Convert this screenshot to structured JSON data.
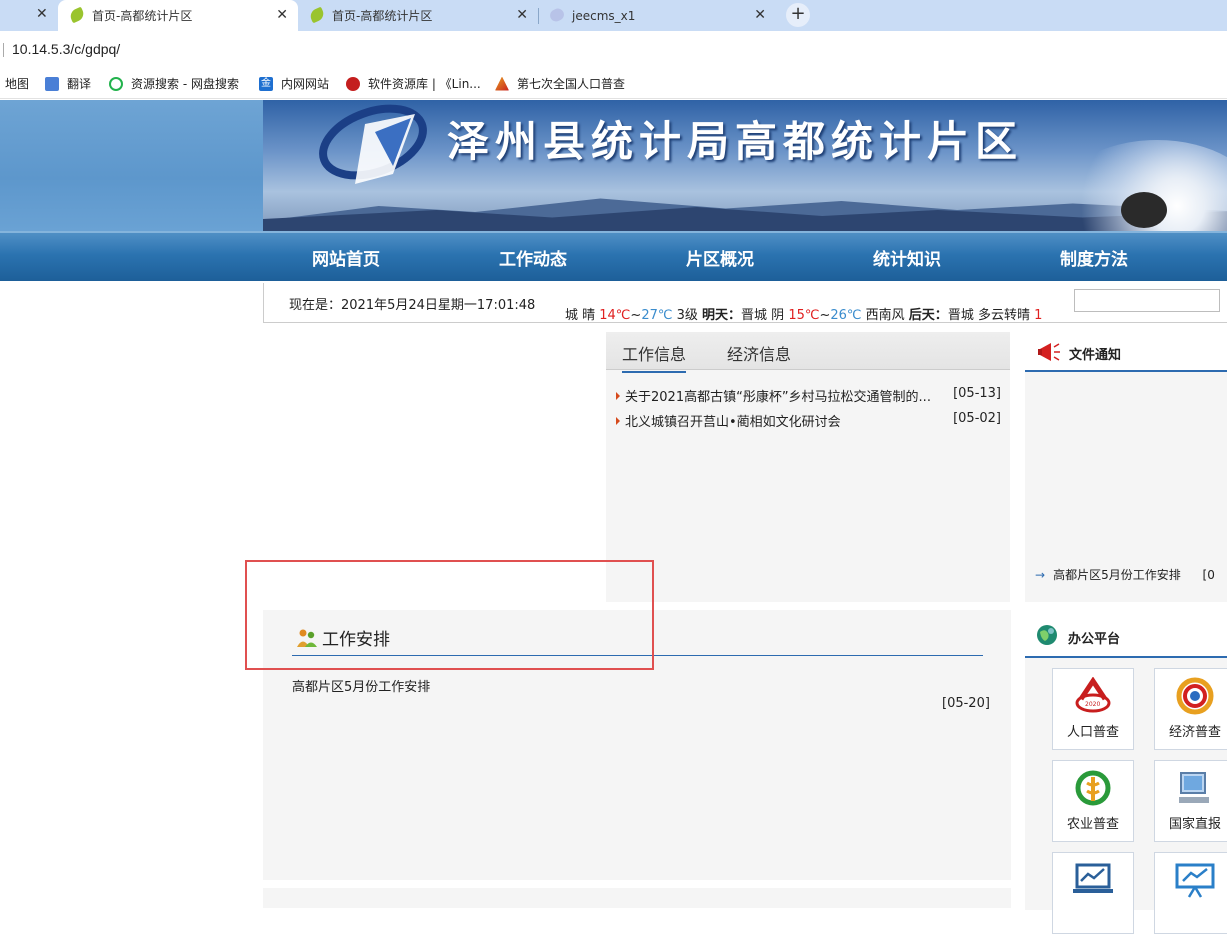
{
  "browser": {
    "tabs": [
      {
        "title": "首页-高都统计片区",
        "active": true
      },
      {
        "title": "首页-高都统计片区",
        "active": false
      },
      {
        "title": "jeecms_x1",
        "active": false
      }
    ],
    "url": "10.14.5.3/c/gdpq/",
    "bookmarks": [
      "地图",
      "翻译",
      "资源搜索 - 网盘搜索",
      "内网网站",
      "软件资源库 | 《Lin...",
      "第七次全国人口普查"
    ]
  },
  "site": {
    "title": "泽州县统计局高都统计片区",
    "nav": [
      "网站首页",
      "工作动态",
      "片区概况",
      "统计知识",
      "制度方法"
    ],
    "datetime": "现在是：2021年5月24日星期一17:01:48",
    "weather": {
      "today_prefix": "城 晴 ",
      "today_low": "14℃",
      "sep1": "~",
      "today_high": "27℃",
      "today_wind": " 3级 ",
      "tomorrow_label": "明天：",
      "tomorrow_desc": "晋城 阴 ",
      "tomorrow_low": "15℃",
      "sep2": "~",
      "tomorrow_high": "26℃",
      "tomorrow_wind": " 西南风 ",
      "after_label": "后天：",
      "after_desc": "晋城 多云转晴 ",
      "after_tail": "1"
    },
    "search_placeholder": ""
  },
  "news": {
    "tabs": [
      "工作信息",
      "经济信息"
    ],
    "items": [
      {
        "title": "关于2021高都古镇“彤康杯”乡村马拉松交通管制的...",
        "date": "[05-13]"
      },
      {
        "title": "北义城镇召开莒山•蔺相如文化研讨会",
        "date": "[05-02]"
      }
    ]
  },
  "notice": {
    "title": "文件通知",
    "items": [
      {
        "title": "高都片区5月份工作安排",
        "date": "[0"
      }
    ]
  },
  "work": {
    "title": "工作安排",
    "items": [
      {
        "title": "高都片区5月份工作安排",
        "date": "[05-20]"
      }
    ]
  },
  "office": {
    "title": "办公平台",
    "tiles": [
      "人口普查",
      "经济普查",
      "农业普查",
      "国家直报",
      "",
      ""
    ]
  },
  "colors": {
    "nav_bg": "#2b73b0",
    "accent": "#2d6bb0",
    "red": "#e02020",
    "blue": "#3a8ccd"
  }
}
